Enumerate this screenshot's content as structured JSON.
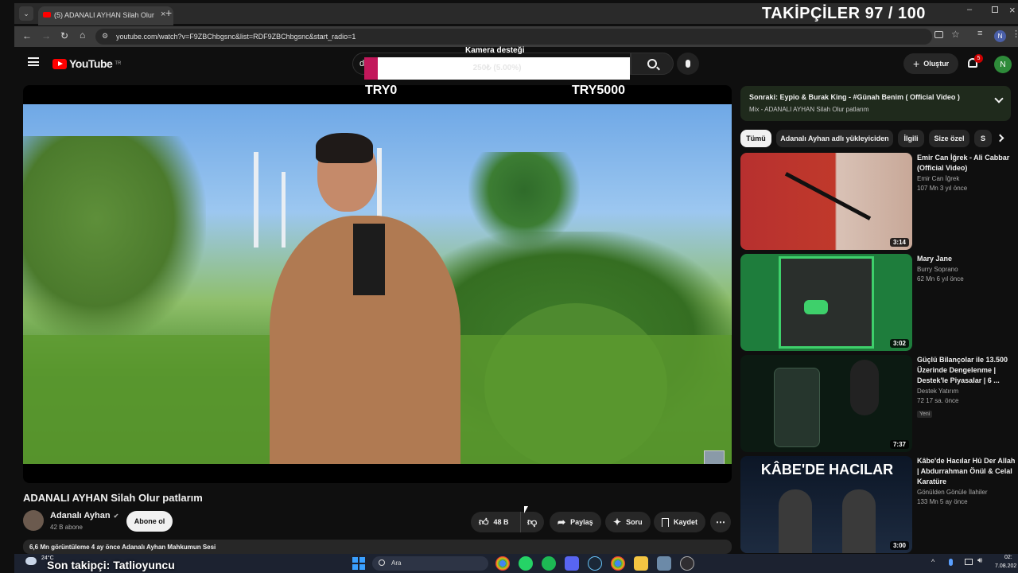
{
  "browser": {
    "tab_title": "(5) ADANALI AYHAN Silah Olur",
    "url": "youtube.com/watch?v=F9ZBChbgsnc&list=RDF9ZBChbgsnc&start_radio=1",
    "profile_initial": "N"
  },
  "overlay": {
    "followers": "TAKİPÇİLER 97 / 100",
    "camera_label": "Kamera desteği",
    "progress_text": "250₺ (5.00%)",
    "progress_fraction": 0.05,
    "goal_min": "TRY0",
    "goal_max": "TRY5000",
    "last_follower": "Son takipçi: Tatlioyuncu"
  },
  "youtube": {
    "logo_text": "YouTube",
    "logo_region": "TR",
    "search_value": "d",
    "create_label": "Oluştur",
    "notification_count": "5",
    "avatar_initial": "N"
  },
  "video": {
    "title": "ADANALI AYHAN Silah Olur patlarım",
    "channel_name": "Adanalı Ayhan",
    "subscribers": "42 B abone",
    "subscribe_label": "Abone ol",
    "likes": "48 B",
    "share_label": "Paylaş",
    "ask_label": "Soru",
    "save_label": "Kaydet",
    "description_line": "6,6 Mn görüntüleme  4 ay önce  Adanalı Ayhan Mahkumun Sesi"
  },
  "playlist": {
    "next_label": "Sonraki:",
    "next_title": "Eypio & Burak King - #Günah Benim ( Official Video )",
    "mix_label": "Mix - ADANALI AYHAN Silah Olur patlarım"
  },
  "chips": [
    "Tümü",
    "Adanalı Ayhan adlı yükleyiciden",
    "İlgili",
    "Size özel",
    "S"
  ],
  "recommendations": [
    {
      "title": "Emir Can İğrek - Ali Cabbar (Official Video)",
      "channel": "Emir Can İğrek",
      "meta": "107 Mn  3 yıl önce",
      "duration": "3:14",
      "badge": ""
    },
    {
      "title": "Mary Jane",
      "channel": "Burry Soprano",
      "meta": "62 Mn  6 yıl önce",
      "duration": "3:02",
      "badge": ""
    },
    {
      "title": "Güçlü Bilançolar ile 13.500 Üzerinde Dengelenme | Destek'le Piyasalar | 6 ...",
      "channel": "Destek Yatırım",
      "meta": "72  17 sa. önce",
      "duration": "7:37",
      "badge": "Yeni"
    },
    {
      "title": "Kâbe'de Hacılar Hû Der Allah | Abdurrahman Önül & Celal Karatüre",
      "channel": "Gönülden Gönüle İlahiler",
      "meta": "133 Mn  5 ay önce",
      "duration": "3:00",
      "badge": "KÂBE'DE HACILAR"
    }
  ],
  "taskbar": {
    "weather": "24°C",
    "search_placeholder": "Ara",
    "time": "02:",
    "date": "7.08.202"
  },
  "colors": {
    "accent_red": "#ff0000",
    "progress_pink": "#c2185b",
    "subscribe_bg": "#f1f1f1"
  }
}
